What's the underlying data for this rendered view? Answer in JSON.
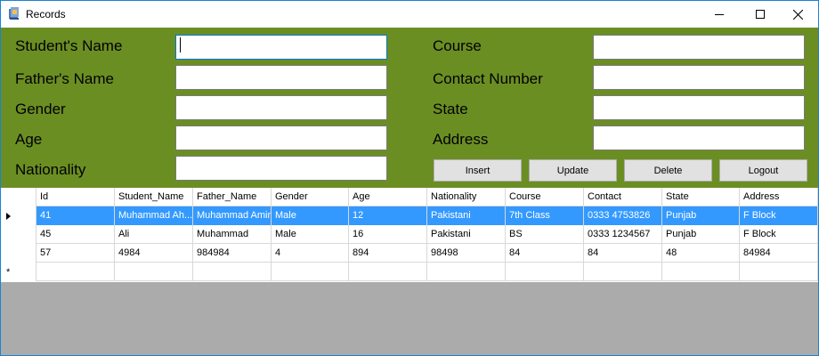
{
  "window": {
    "title": "Records"
  },
  "form": {
    "fields_left": [
      {
        "label": "Student's Name",
        "value": ""
      },
      {
        "label": "Father's Name",
        "value": ""
      },
      {
        "label": "Gender",
        "value": ""
      },
      {
        "label": "Age",
        "value": ""
      },
      {
        "label": "Nationality",
        "value": ""
      }
    ],
    "fields_right": [
      {
        "label": "Course",
        "value": ""
      },
      {
        "label": "Contact Number",
        "value": ""
      },
      {
        "label": "State",
        "value": ""
      },
      {
        "label": "Address",
        "value": ""
      }
    ],
    "buttons": {
      "insert": "Insert",
      "update": "Update",
      "delete": "Delete",
      "logout": "Logout"
    }
  },
  "grid": {
    "columns": [
      "Id",
      "Student_Name",
      "Father_Name",
      "Gender",
      "Age",
      "Nationality",
      "Course",
      "Contact",
      "State",
      "Address"
    ],
    "rows": [
      [
        "41",
        "Muhammad Ah...",
        "Muhammad Amin",
        "Male",
        "12",
        "Pakistani",
        "7th Class",
        "0333 4753826",
        "Punjab",
        "F Block"
      ],
      [
        "45",
        "Ali",
        "Muhammad",
        "Male",
        "16",
        "Pakistani",
        "BS",
        "0333 1234567",
        "Punjab",
        "F Block"
      ],
      [
        "57",
        "4984",
        "984984",
        "4",
        "894",
        "98498",
        "84",
        "84",
        "48",
        "84984"
      ]
    ],
    "new_row_marker": "*"
  },
  "colors": {
    "form_bg": "#6b8e23",
    "selection": "#3399ff",
    "empty_area": "#ababab"
  }
}
